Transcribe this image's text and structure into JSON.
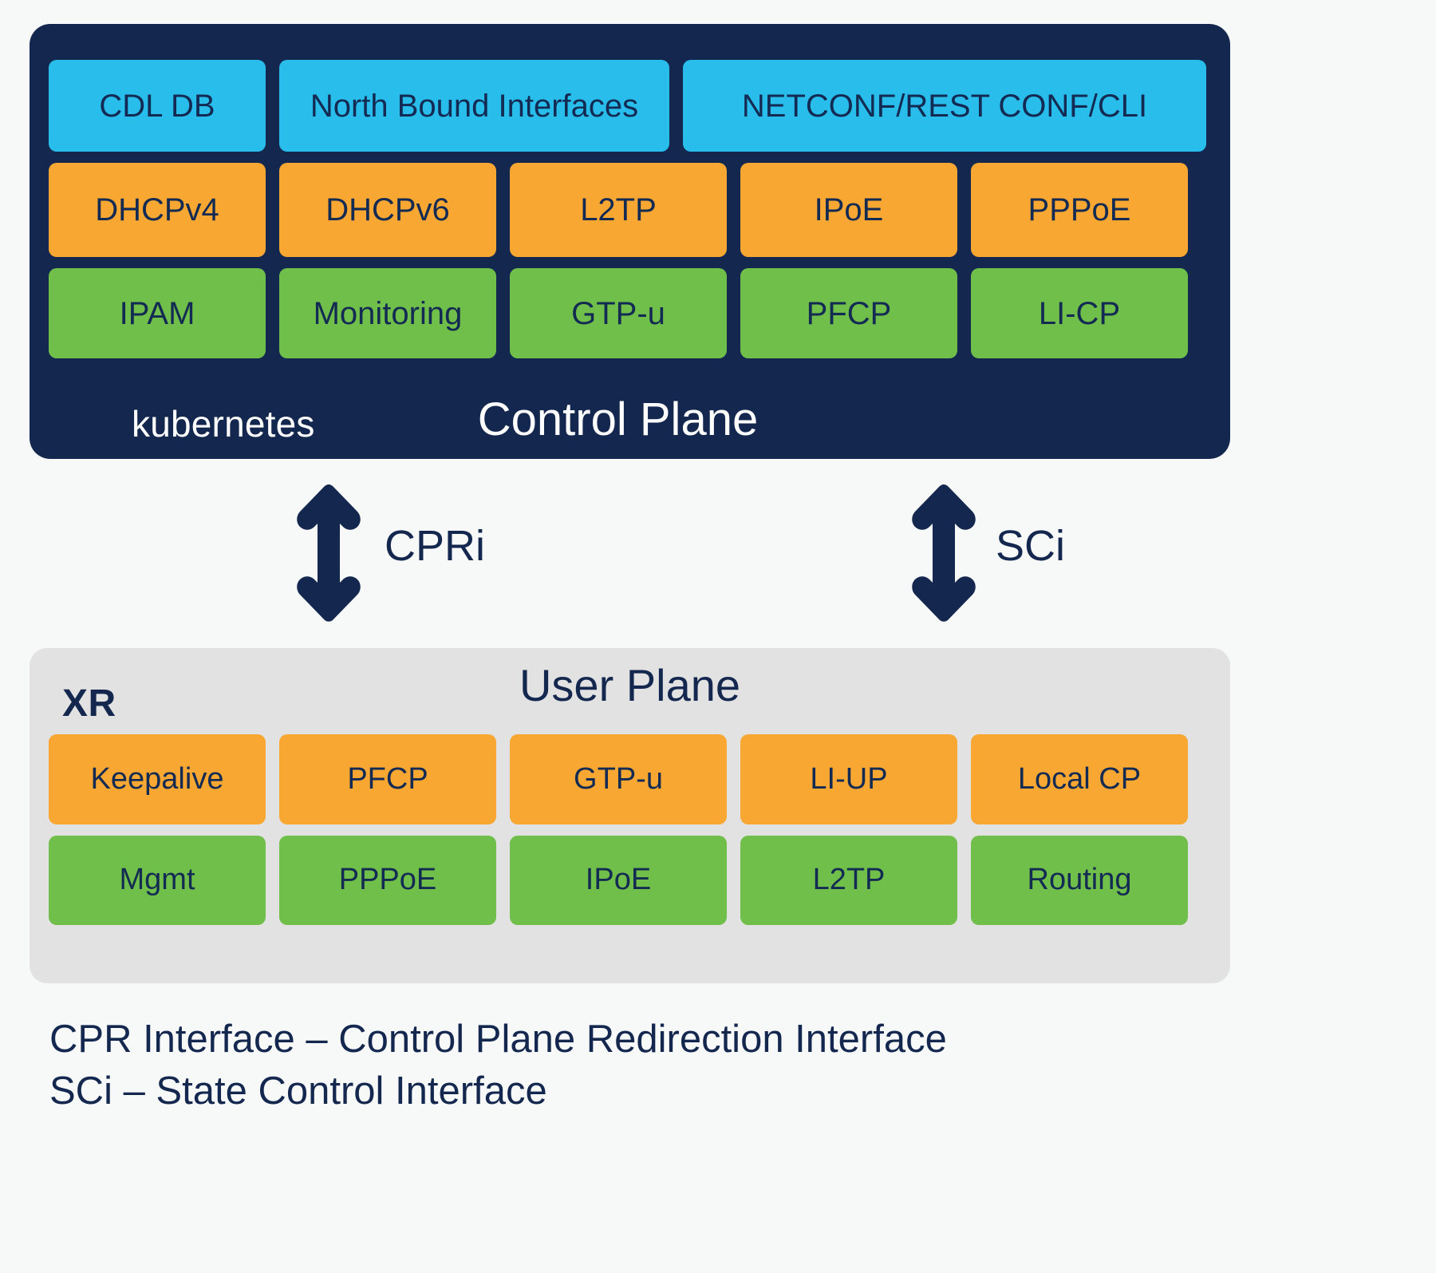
{
  "colors": {
    "background": "#f7f8f8",
    "control_plane_bg": "#14284f",
    "user_plane_bg": "#e2e2e2",
    "cyan": "#29bdec",
    "orange": "#f8a832",
    "green": "#70bf4a",
    "navy_text": "#14284f",
    "white_text": "#ffffff"
  },
  "control_plane": {
    "title": "Control Plane",
    "platform_label": "kubernetes",
    "row_cyan": [
      {
        "label": "CDL DB"
      },
      {
        "label": "North Bound Interfaces"
      },
      {
        "label": "NETCONF/REST CONF/CLI"
      }
    ],
    "row_orange": [
      {
        "label": "DHCPv4"
      },
      {
        "label": "DHCPv6"
      },
      {
        "label": "L2TP"
      },
      {
        "label": "IPoE"
      },
      {
        "label": "PPPoE"
      }
    ],
    "row_green": [
      {
        "label": "IPAM"
      },
      {
        "label": "Monitoring"
      },
      {
        "label": "GTP-u"
      },
      {
        "label": "PFCP"
      },
      {
        "label": "LI-CP"
      }
    ]
  },
  "connectors": [
    {
      "label": "CPRi",
      "icon": "double-arrow-vertical-icon"
    },
    {
      "label": "SCi",
      "icon": "double-arrow-vertical-icon"
    }
  ],
  "user_plane": {
    "title": "User Plane",
    "platform_label": "XR",
    "row_orange": [
      {
        "label": "Keepalive"
      },
      {
        "label": "PFCP"
      },
      {
        "label": "GTP-u"
      },
      {
        "label": "LI-UP"
      },
      {
        "label": "Local CP"
      }
    ],
    "row_green": [
      {
        "label": "Mgmt"
      },
      {
        "label": "PPPoE"
      },
      {
        "label": "IPoE"
      },
      {
        "label": "L2TP"
      },
      {
        "label": "Routing"
      }
    ]
  },
  "legend": {
    "line_1": "CPR Interface – Control Plane Redirection Interface",
    "line_2": "SCi – State Control Interface"
  }
}
